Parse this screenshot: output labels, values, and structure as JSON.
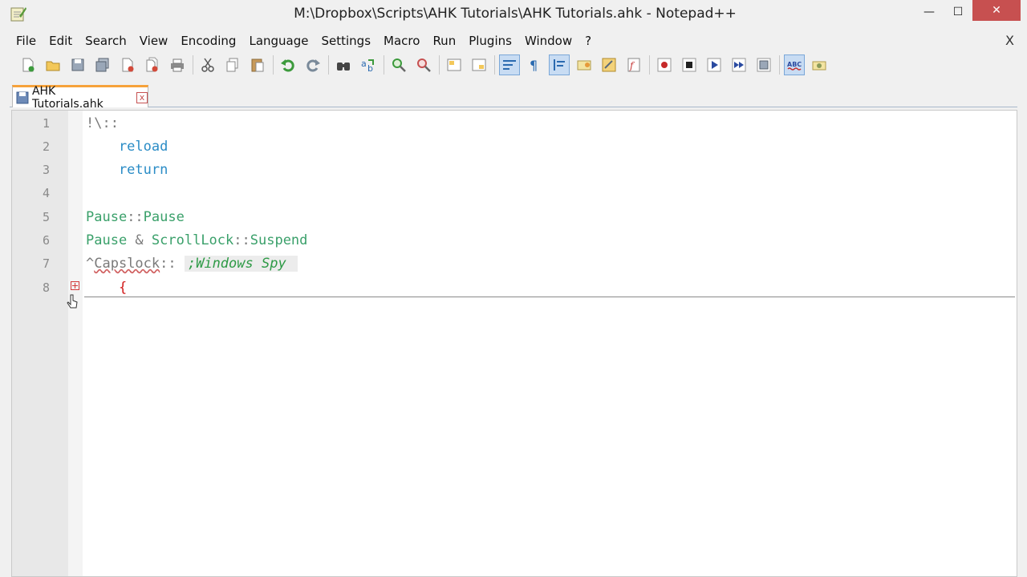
{
  "window": {
    "title": "M:\\Dropbox\\Scripts\\AHK Tutorials\\AHK Tutorials.ahk - Notepad++",
    "minimize": "—",
    "maximize": "☐",
    "close": "✕"
  },
  "menu": {
    "items": [
      "File",
      "Edit",
      "Search",
      "View",
      "Encoding",
      "Language",
      "Settings",
      "Macro",
      "Run",
      "Plugins",
      "Window",
      "?"
    ],
    "close": "X"
  },
  "tab": {
    "label": "AHK Tutorials.ahk",
    "close": "x"
  },
  "editor": {
    "lines": [
      {
        "num": "1",
        "tokens": [
          {
            "t": "!\\::",
            "c": "c-op"
          }
        ]
      },
      {
        "num": "2",
        "tokens": [
          {
            "t": "    reload",
            "c": "c-cmd"
          }
        ]
      },
      {
        "num": "3",
        "tokens": [
          {
            "t": "    return",
            "c": "c-cmd"
          }
        ]
      },
      {
        "num": "4",
        "tokens": []
      },
      {
        "num": "5",
        "tokens": [
          {
            "t": "Pause",
            "c": "c-label"
          },
          {
            "t": "::",
            "c": "c-op"
          },
          {
            "t": "Pause",
            "c": "c-label"
          }
        ]
      },
      {
        "num": "6",
        "tokens": [
          {
            "t": "Pause ",
            "c": "c-label"
          },
          {
            "t": "& ",
            "c": "c-op"
          },
          {
            "t": "ScrollLock",
            "c": "c-label"
          },
          {
            "t": "::",
            "c": "c-op"
          },
          {
            "t": "Suspend",
            "c": "c-label"
          }
        ]
      },
      {
        "num": "7",
        "tokens": [
          {
            "t": "^",
            "c": "c-op"
          },
          {
            "t": "Capslock",
            "c": "c-op squiggle"
          },
          {
            "t": ":: ",
            "c": "c-op"
          },
          {
            "t": ";Windows Spy ",
            "c": "c-comment"
          }
        ]
      },
      {
        "num": "8",
        "tokens": [
          {
            "t": "    {",
            "c": "c-brace"
          }
        ]
      }
    ]
  },
  "colors": {
    "tab_accent": "#f6a23a",
    "label_green": "#3aa06a",
    "command_blue": "#2a8cc6",
    "comment_green": "#2e9a46",
    "brace_red": "#d11a1a",
    "close_red": "#c75050"
  },
  "toolbar_icons": [
    "new-file-icon",
    "open-file-icon",
    "save-icon",
    "save-all-icon",
    "close-icon",
    "close-all-icon",
    "print-icon",
    "cut-icon",
    "copy-icon",
    "paste-icon",
    "undo-icon",
    "redo-icon",
    "find-icon",
    "replace-icon",
    "zoom-in-icon",
    "zoom-out-icon",
    "sync-vertical-icon",
    "sync-horizontal-icon",
    "word-wrap-icon",
    "show-all-chars-icon",
    "indent-guide-icon",
    "user-defined-lang-icon",
    "doc-map-icon",
    "function-list-icon",
    "record-macro-icon",
    "stop-record-icon",
    "play-macro-icon",
    "run-macro-multiple-icon",
    "save-macro-icon",
    "spellcheck-icon",
    "spellcheck-options-icon"
  ]
}
